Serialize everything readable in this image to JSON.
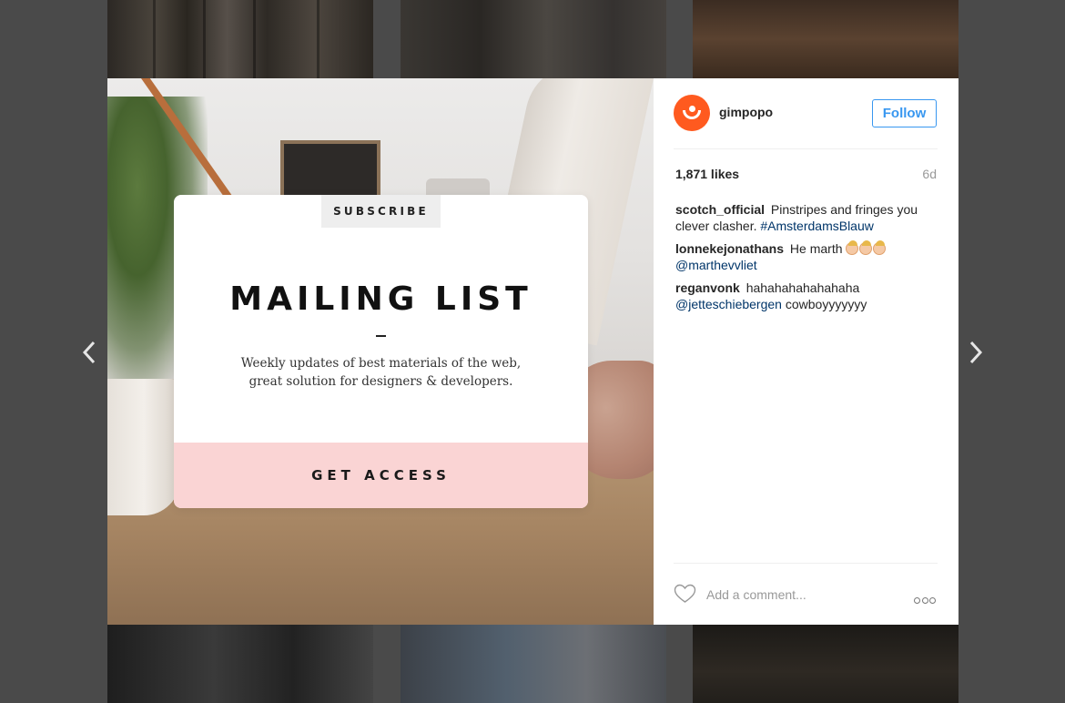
{
  "post": {
    "username": "gimpopo",
    "follow_label": "Follow",
    "likes": "1,871 likes",
    "age": "6d"
  },
  "promo": {
    "tag": "SUBSCRIBE",
    "title": "MAILING LIST",
    "description_line1": "Weekly updates of best materials of the web,",
    "description_line2": "great solution for designers & developers.",
    "cta_label": "GET ACCESS"
  },
  "comments": [
    {
      "author": "scotch_official",
      "text": "Pinstripes and fringes you clever clasher.",
      "hashtag": "#AmsterdamsBlauw"
    },
    {
      "author": "lonnekejonathans",
      "text": "He marth",
      "mention": "@marthevvliet"
    },
    {
      "author": "reganvonk",
      "text": "hahahahahahahaha",
      "mention": "@jetteschiebergen",
      "text_after": "cowboyyyyyyy"
    }
  ],
  "comment_box": {
    "placeholder": "Add a comment..."
  },
  "icons": {
    "prev": "chevron-left-icon",
    "next": "chevron-right-icon",
    "like": "heart-icon",
    "more": "more-options-icon",
    "avatar": "smiley-avatar"
  },
  "colors": {
    "backdrop": "#4a4a4a",
    "follow_blue": "#3897f0",
    "avatar_orange": "#ff5a1f",
    "cta_pink": "#fad4d4",
    "link_blue": "#003569"
  }
}
